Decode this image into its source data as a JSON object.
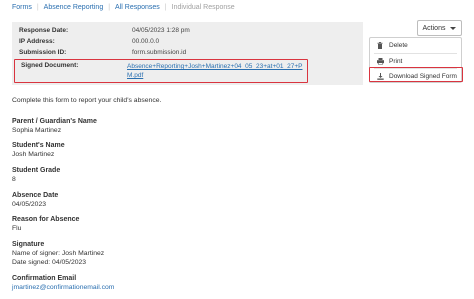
{
  "breadcrumb": {
    "items": [
      "Forms",
      "Absence Reporting",
      "All Responses"
    ],
    "current": "Individual Response"
  },
  "meta": {
    "rows": [
      {
        "label": "Response Date:",
        "value": "04/05/2023 1:28 pm"
      },
      {
        "label": "IP Address:",
        "value": "00.00.0.0"
      },
      {
        "label": "Submission ID:",
        "value": "form.submission.id"
      }
    ],
    "signed_label": "Signed Document:",
    "signed_link": "Absence+Reporting+Josh+Martinez+04_05_23+at+01_27+PM.pdf"
  },
  "actions": {
    "label": "Actions",
    "menu": [
      {
        "icon": "trash-icon",
        "label": "Delete"
      },
      {
        "icon": "printer-icon",
        "label": "Print"
      },
      {
        "icon": "download-icon",
        "label": "Download Signed Form"
      }
    ]
  },
  "form": {
    "intro": "Complete this form to report your child's absence.",
    "fields": [
      {
        "label": "Parent / Guardian's Name",
        "values": [
          "Sophia Martinez"
        ]
      },
      {
        "label": "Student's Name",
        "values": [
          "Josh Martinez"
        ]
      },
      {
        "label": "Student Grade",
        "values": [
          "8"
        ]
      },
      {
        "label": "Absence Date",
        "values": [
          "04/05/2023"
        ]
      },
      {
        "label": "Reason for Absence",
        "values": [
          "Flu"
        ]
      },
      {
        "label": "Signature",
        "values": [
          "Name of signer: Josh Martinez",
          "Date signed: 04/05/2023"
        ]
      },
      {
        "label": "Confirmation Email",
        "values": [
          "jmartinez@confirmationemail.com"
        ]
      }
    ]
  },
  "colors": {
    "link": "#2a6fb0",
    "highlight": "#d9343f",
    "meta_bg": "#eeeeee"
  }
}
